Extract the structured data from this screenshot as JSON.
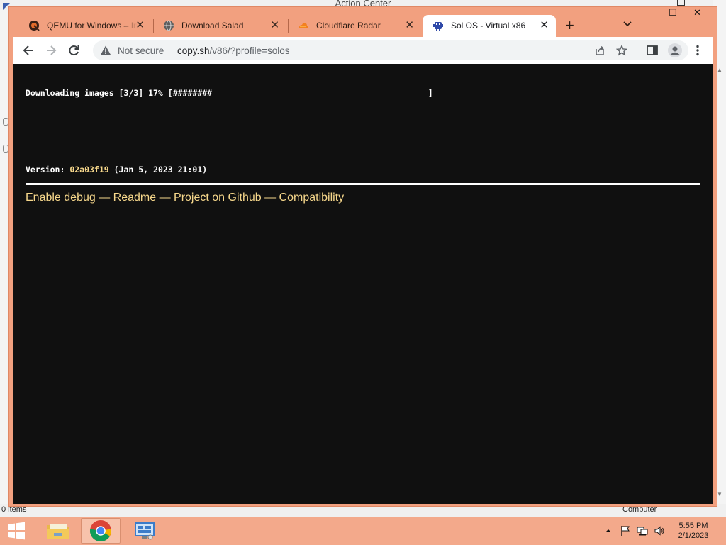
{
  "background_window": {
    "title": "Action Center",
    "status_items": "0 items",
    "status_computer": "Computer"
  },
  "browser": {
    "tabs": [
      {
        "label": "QEMU for Windows – Installers",
        "icon": "qemu-icon",
        "active": false
      },
      {
        "label": "Download Salad",
        "icon": "globe-icon",
        "active": false
      },
      {
        "label": "Cloudflare Radar",
        "icon": "cloudflare-icon",
        "active": false
      },
      {
        "label": "Sol OS - Virtual x86",
        "icon": "v86-icon",
        "active": true
      }
    ],
    "new_tab_label": "+",
    "omnibox": {
      "security": "Not secure",
      "url_host": "copy.sh",
      "url_path": "/v86/?profile=solos"
    },
    "window_controls": {
      "minimize": "—",
      "maximize": "☐",
      "close": "✕"
    }
  },
  "page": {
    "download_line": "Downloading images [3/3] 17% [########                                            ]",
    "download_progress_percent": 17,
    "version_label": "Version: ",
    "version_hash": "02a03f19",
    "version_date": " (Jan 5, 2023 21:01)",
    "links": [
      {
        "label": "Enable debug"
      },
      {
        "label": "Readme"
      },
      {
        "label": "Project on Github"
      },
      {
        "label": "Compatibility"
      }
    ],
    "link_separator": " — ",
    "colors": {
      "background": "#101010",
      "accent": "#f6d78b",
      "text": "#ffffff"
    }
  },
  "taskbar": {
    "apps": [
      {
        "name": "file-explorer",
        "icon": "folder-icon"
      },
      {
        "name": "chrome",
        "icon": "chrome-icon"
      },
      {
        "name": "control-panel",
        "icon": "control-panel-icon"
      }
    ],
    "clock_time": "5:55 PM",
    "clock_date": "2/1/2023",
    "accent": "#f3a98b"
  }
}
